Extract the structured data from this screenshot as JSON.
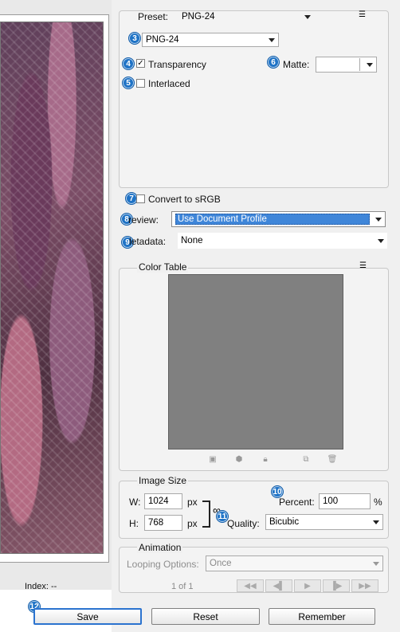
{
  "preview": {
    "index_text": "Index: --"
  },
  "preset": {
    "label": "Preset:",
    "value": "PNG-24"
  },
  "format": {
    "value": "PNG-24"
  },
  "options": {
    "transparency_label": "Transparency",
    "transparency_checked": true,
    "interlaced_label": "Interlaced",
    "interlaced_checked": false,
    "matte_label": "Matte:",
    "matte_value": ""
  },
  "conversion": {
    "convert_label": "Convert to sRGB",
    "preview_label": "review:",
    "preview_value": "Use Document Profile",
    "metadata_label": "letadata:",
    "metadata_value": "None"
  },
  "color_table": {
    "title": "Color Table"
  },
  "image_size": {
    "title": "Image Size",
    "width_label": "W:",
    "width_value": "1024",
    "height_label": "H:",
    "height_value": "768",
    "unit": "px",
    "percent_label": "Percent:",
    "percent_value": "100",
    "percent_sign": "%",
    "quality_label": "Quality:",
    "quality_value": "Bicubic"
  },
  "animation": {
    "title": "Animation",
    "looping_label": "Looping Options:",
    "looping_value": "Once",
    "frame_text": "1 of 1"
  },
  "buttons": {
    "save": "Save",
    "reset": "Reset",
    "remember": "Remember"
  },
  "badges": {
    "b3": "3",
    "b4": "4",
    "b5": "5",
    "b6": "6",
    "b7": "7",
    "b8": "8",
    "b9": "9",
    "b10": "10",
    "b11": "11",
    "b12": "12"
  },
  "icons": {
    "menu": "☰",
    "chain": "∞"
  },
  "colors": {
    "accent": "#1f73c6",
    "selected": "#3f86d9",
    "swatch": "#808080"
  }
}
